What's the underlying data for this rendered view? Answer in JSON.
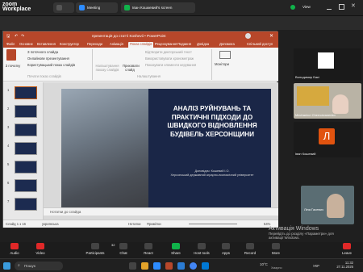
{
  "zoom_top": {
    "logo": "zoom Workplace",
    "tab_home_icon": "home-icon",
    "tab_meeting": "Meeting",
    "share_tab": "Іван Кошкевий's screen",
    "view": "View"
  },
  "ppt": {
    "title": "презентація до статті Koshevii  •  PowerPoint",
    "ribbon_tabs": [
      "Файл",
      "Основне",
      "Вставлення",
      "Конструктор",
      "Переходи",
      "Анімація",
      "Показ слайдів",
      "Рецензування",
      "Подання",
      "Довідка",
      "Допомога",
      "Спільний доступ"
    ],
    "active_tab": "Показ слайдів",
    "ribbon": {
      "from_start": "З початку",
      "from_slide": "З поточного слайда",
      "online": "Онлайнове презентування",
      "custom": "Користувацький показ слайдів",
      "group_start": "Почати показ слайдів",
      "setup": "Налаштування показу слайдів",
      "hide_slide": "Приховати слайд",
      "rehearse": "Відпрацювати демонстрування",
      "record": "Записати",
      "play_narr": "Відтворити дикторський текст",
      "use_timings": "Використовувати хронометраж",
      "show_media": "Показувати елементи керування",
      "group_setup": "Налаштування",
      "monitors": "Монітори"
    },
    "slide_numbers": [
      "1",
      "2",
      "3",
      "4",
      "5",
      "6",
      "7"
    ],
    "slide": {
      "title": "АНАЛІЗ РУЙНУВАНЬ ТА ПРАКТИЧНІ ПІДХОДИ ДО ШВИДКОГО ВІДНОВЛЕННЯ БУДІВЕЛЬ ХЕРСОНЩИНИ",
      "author_1": "Доповідач: Кошевий І.О.",
      "author_2": "Херсонський державний аграрно-економічний університет"
    },
    "notes": "Нотатки до слайда",
    "status_left": "Слайд 1 з 16",
    "status_lang": "українська",
    "status_notes": "Нотатки",
    "status_comments": "Примітки",
    "zoom_pct": "54%"
  },
  "participants": [
    {
      "name": "Володимир Бакі"
    },
    {
      "name": "Mechaniсл Chernoivanenko"
    },
    {
      "name": "Іван Кошевий"
    },
    {
      "name": "Ліна Гасевич"
    }
  ],
  "activate": {
    "line1": "Активація Windows",
    "line2": "Перейдіть до розділу «Параметри» для",
    "line3": "активації Windows."
  },
  "controls": [
    {
      "label": "Audio"
    },
    {
      "label": "Video"
    },
    {
      "label": "Participants"
    },
    {
      "label": "Chat"
    },
    {
      "label": "React"
    },
    {
      "label": "Share"
    },
    {
      "label": "Host tools"
    },
    {
      "label": "Apps"
    },
    {
      "label": "Record"
    },
    {
      "label": "More"
    },
    {
      "label": "Leave"
    }
  ],
  "participants_count": "32",
  "taskbar": {
    "search": "Пошук",
    "weather": "10°C",
    "weather_desc": "Хмарно",
    "lang": "УКР",
    "time": "11:32",
    "date": "27.11.2025"
  },
  "colors": {
    "ppt_accent": "#b7472a",
    "leave": "#e02828",
    "share": "#10b34a"
  }
}
